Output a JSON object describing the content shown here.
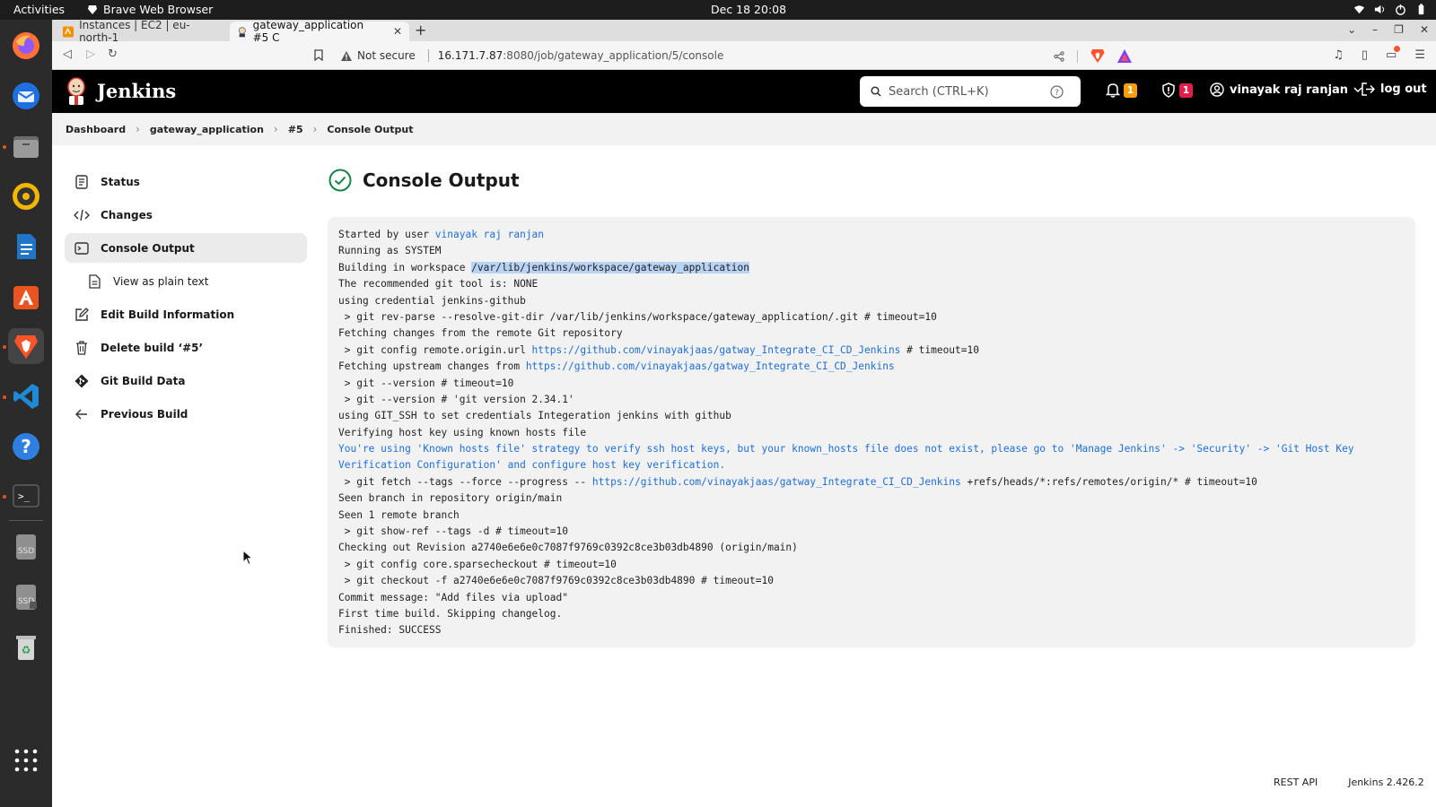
{
  "system": {
    "activities": "Activities",
    "app_name": "Brave Web Browser",
    "clock": "Dec 18  20:08"
  },
  "dock": {
    "items": [
      "firefox-icon",
      "thunderbird-icon",
      "files-icon",
      "rhythmbox-icon",
      "writer-icon",
      "app-center-icon",
      "brave-icon",
      "vscode-icon",
      "help-icon",
      "terminal-icon",
      "ssd-drive-icon",
      "ssd-drive-2-icon",
      "trash-icon",
      "show-apps-icon"
    ]
  },
  "browser": {
    "tabs": [
      {
        "label": "Instances | EC2 | eu-north-1",
        "active": false
      },
      {
        "label": "gateway_application #5 C",
        "active": true
      }
    ],
    "not_secure": "Not secure",
    "url_host": "16.171.7.87",
    "url_path": ":8080/job/gateway_application/5/console"
  },
  "jenkins": {
    "title": "Jenkins",
    "search_placeholder": "Search (CTRL+K)",
    "notifications_count": "1",
    "security_count": "1",
    "user": "vinayak raj ranjan",
    "logout": "log out"
  },
  "breadcrumb": [
    "Dashboard",
    "gateway_application",
    "#5",
    "Console Output"
  ],
  "side": {
    "items": [
      {
        "label": "Status"
      },
      {
        "label": "Changes"
      },
      {
        "label": "Console Output"
      },
      {
        "label": "View as plain text"
      },
      {
        "label": "Edit Build Information"
      },
      {
        "label": "Delete build ‘#5’"
      },
      {
        "label": "Git Build Data"
      },
      {
        "label": "Previous Build"
      }
    ]
  },
  "main": {
    "heading": "Console Output"
  },
  "console": {
    "l1_pre": "Started by user ",
    "l1_link": "vinayak raj ranjan",
    "l2": "Running as SYSTEM",
    "l3_pre": "Building in workspace ",
    "l3_hl": "/var/lib/jenkins/workspace/gateway_application",
    "l4": "The recommended git tool is: NONE",
    "l5": "using credential jenkins-github",
    "l6": " > git rev-parse --resolve-git-dir /var/lib/jenkins/workspace/gateway_application/.git # timeout=10",
    "l7": "Fetching changes from the remote Git repository",
    "l8_pre": " > git config remote.origin.url ",
    "l8_link": "https://github.com/vinayakjaas/gatway_Integrate_CI_CD_Jenkins",
    "l8_post": " # timeout=10",
    "l9_pre": "Fetching upstream changes from ",
    "l9_link": "https://github.com/vinayakjaas/gatway_Integrate_CI_CD_Jenkins",
    "l10": " > git --version # timeout=10",
    "l11": " > git --version # 'git version 2.34.1'",
    "l12": "using GIT_SSH to set credentials Integeration jenkins with github",
    "l13": "Verifying host key using known hosts file",
    "l14": "You're using 'Known hosts file' strategy to verify ssh host keys, but your known_hosts file does not exist, please go to 'Manage Jenkins' -> 'Security' -> 'Git Host Key",
    "l15": "Verification Configuration' and configure host key verification.",
    "l16_pre": " > git fetch --tags --force --progress -- ",
    "l16_link": "https://github.com/vinayakjaas/gatway_Integrate_CI_CD_Jenkins",
    "l16_post": " +refs/heads/*:refs/remotes/origin/* # timeout=10",
    "l17": "Seen branch in repository origin/main",
    "l18": "Seen 1 remote branch",
    "l19": " > git show-ref --tags -d # timeout=10",
    "l20": "Checking out Revision a2740e6e6e0c7087f9769c0392c8ce3b03db4890 (origin/main)",
    "l21": " > git config core.sparsecheckout # timeout=10",
    "l22": " > git checkout -f a2740e6e6e0c7087f9769c0392c8ce3b03db4890 # timeout=10",
    "l23": "Commit message: \"Add files via upload\"",
    "l24": "First time build. Skipping changelog.",
    "l25": "Finished: SUCCESS"
  },
  "footer": {
    "rest_api": "REST API",
    "version": "Jenkins 2.426.2"
  },
  "colors": {
    "accent_link": "#1e6fd9",
    "success": "#138347",
    "badge_orange": "#f59e0b",
    "badge_red": "#e11d48",
    "ubuntu_orange": "#e95420"
  }
}
